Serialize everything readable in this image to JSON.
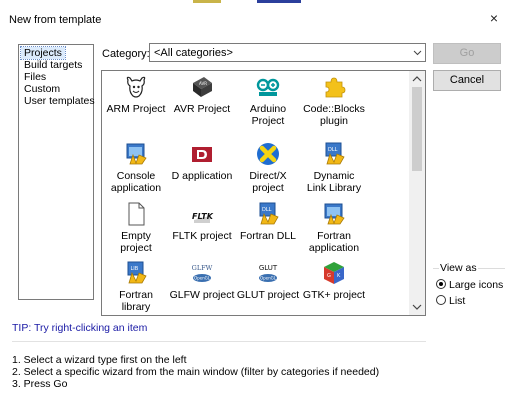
{
  "window": {
    "title": "New from template",
    "close_glyph": "×"
  },
  "colors": {
    "selection": "#dcebfc",
    "tip_text": "#1a1aa5",
    "button_bg": "#e1e1e1",
    "disabled_text": "#a0a0a0"
  },
  "wizard_types": {
    "items": [
      {
        "label": "Projects",
        "selected": true
      },
      {
        "label": "Build targets",
        "selected": false
      },
      {
        "label": "Files",
        "selected": false
      },
      {
        "label": "Custom",
        "selected": false
      },
      {
        "label": "User templates",
        "selected": false
      }
    ]
  },
  "category": {
    "label": "Category:",
    "value": "<All categories>"
  },
  "templates": [
    {
      "label": "ARM Project",
      "icon": "gnu-head-icon"
    },
    {
      "label": "AVR Project",
      "icon": "avr-chip-icon"
    },
    {
      "label": "Arduino Project",
      "label_line1": "Arduino",
      "label_line2": "Project",
      "icon": "arduino-logo-icon"
    },
    {
      "label": "Code::Blocks plugin",
      "label_line1": "Code::Blocks",
      "label_line2": "plugin",
      "icon": "puzzle-piece-icon"
    },
    {
      "label": "Console application",
      "label_line1": "Console",
      "label_line2": "application",
      "icon": "console-app-icon"
    },
    {
      "label": "D application",
      "icon": "d-language-icon"
    },
    {
      "label": "Direct/X project",
      "label_line1": "Direct/X",
      "label_line2": "project",
      "icon": "directx-icon"
    },
    {
      "label": "Dynamic Link Library",
      "label_line1": "Dynamic",
      "label_line2": "Link Library",
      "icon": "dll-icon"
    },
    {
      "label": "Empty project",
      "label_line1": "Empty",
      "label_line2": "project",
      "icon": "empty-page-icon"
    },
    {
      "label": "FLTK project",
      "icon": "fltk-logo-icon"
    },
    {
      "label": "Fortran DLL",
      "icon": "fortran-dll-icon"
    },
    {
      "label": "Fortran application",
      "label_line1": "Fortran",
      "label_line2": "application",
      "icon": "fortran-app-icon"
    },
    {
      "label": "Fortran library",
      "label_line1": "Fortran",
      "label_line2": "library",
      "icon": "fortran-lib-icon"
    },
    {
      "label": "GLFW project",
      "icon": "glfw-logo-icon",
      "icon_text": "GLFW"
    },
    {
      "label": "GLUT project",
      "icon": "glut-logo-icon",
      "icon_text": "GLUT"
    },
    {
      "label": "GTK+ project",
      "icon": "gtk-cube-icon"
    }
  ],
  "buttons": {
    "go": "Go",
    "cancel": "Cancel"
  },
  "view_as": {
    "label": "View as",
    "options": [
      {
        "label": "Large icons",
        "checked": true
      },
      {
        "label": "List",
        "checked": false
      }
    ]
  },
  "tip": "TIP: Try right-clicking an item",
  "help_lines": [
    "1. Select a wizard type first on the left",
    "2. Select a specific wizard from the main window (filter by categories if needed)",
    "3. Press Go"
  ]
}
